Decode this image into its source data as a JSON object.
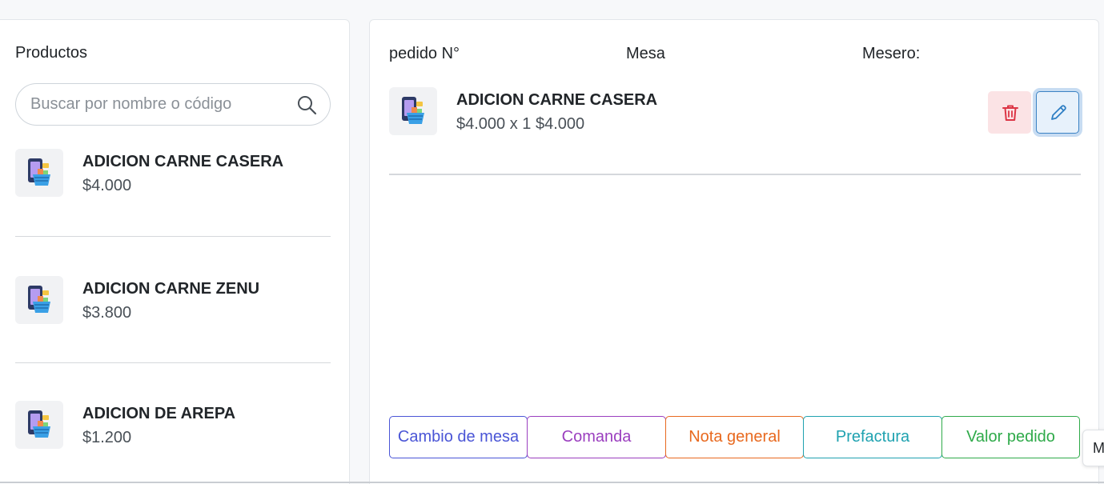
{
  "products_panel": {
    "title": "Productos",
    "search_placeholder": "Buscar por nombre o código",
    "items": [
      {
        "name": "ADICION CARNE CASERA",
        "price": "$4.000"
      },
      {
        "name": "ADICION CARNE ZENU",
        "price": "$3.800"
      },
      {
        "name": "ADICION DE AREPA",
        "price": "$1.200"
      }
    ]
  },
  "order_panel": {
    "order_number_label": "pedido N°",
    "table_label": "Mesa",
    "waiter_label": "Mesero:",
    "items": [
      {
        "name": "ADICION CARNE CASERA",
        "detail": "$4.000 x 1 $4.000"
      }
    ],
    "actions": [
      {
        "label": "Cambio de mesa",
        "color": "#4a55d6"
      },
      {
        "label": "Comanda",
        "color": "#9b3fbf"
      },
      {
        "label": "Nota general",
        "color": "#e8691f"
      },
      {
        "label": "Prefactura",
        "color": "#1fa2b0"
      },
      {
        "label": "Valor pedido",
        "color": "#2faa4a"
      }
    ]
  },
  "edge_tab_label": "M",
  "icons": {
    "search": "search-icon",
    "product": "product-basket-icon",
    "delete": "trash-icon",
    "edit": "pencil-icon"
  },
  "colors": {
    "delete_icon": "#dc3545",
    "edit_icon": "#2f7fc4"
  }
}
